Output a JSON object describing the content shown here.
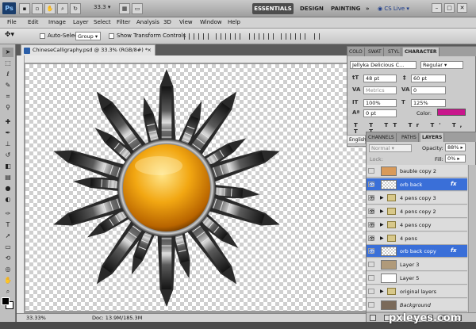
{
  "titlebar": {
    "logo": "Ps",
    "zoom": "33.3",
    "workspaces": [
      "ESSENTIALS",
      "DESIGN",
      "PAINTING"
    ],
    "more": "»",
    "cslive": "CS Live",
    "win_min": "–",
    "win_max": "□",
    "win_close": "✕"
  },
  "menu": [
    "File",
    "Edit",
    "Image",
    "Layer",
    "Select",
    "Filter",
    "Analysis",
    "3D",
    "View",
    "Window",
    "Help"
  ],
  "options": {
    "auto_select_label": "Auto-Select:",
    "auto_select_value": "Group",
    "show_transform_label": "Show Transform Controls"
  },
  "document": {
    "tab_title": "ChineseCalligraphy.psd @ 33.3% (RGB/8#) *",
    "zoom_status": "33.33%",
    "doc_status": "Doc: 13.9M/185.3M"
  },
  "character_panel": {
    "tabs": [
      "COLO",
      "SWAT",
      "STYL",
      "CHARACTER"
    ],
    "font_family": "Jellyka Delicious C...",
    "font_style": "Regular",
    "font_size": "48 pt",
    "leading": "60 pt",
    "kerning": "Metrics",
    "tracking": "0",
    "vscale": "100%",
    "hscale": "125%",
    "baseline": "0 pt",
    "color_label": "Color:",
    "text_color": "#c8168c",
    "style_buttons": "T T TT Tr T' T, T T",
    "language": "English"
  },
  "layers_panel": {
    "tabs": [
      "CHANNELS",
      "PATHS",
      "LAYERS"
    ],
    "blend_mode": "Normal",
    "opacity_label": "Opacity:",
    "opacity": "88%",
    "lock_label": "Lock:",
    "fill_label": "Fill:",
    "fill": "0%",
    "layers": [
      {
        "name": "bauble copy 2",
        "type": "image",
        "visible": false,
        "fx": false,
        "selected": false
      },
      {
        "name": "orb back",
        "type": "image",
        "visible": true,
        "fx": true,
        "selected": true
      },
      {
        "name": "4 pens copy 3",
        "type": "group",
        "visible": true,
        "fx": false,
        "selected": false
      },
      {
        "name": "4 pens copy 2",
        "type": "group",
        "visible": true,
        "fx": false,
        "selected": false
      },
      {
        "name": "4 pens copy",
        "type": "group",
        "visible": true,
        "fx": false,
        "selected": false
      },
      {
        "name": "4 pens",
        "type": "group",
        "visible": true,
        "fx": false,
        "selected": false
      },
      {
        "name": "orb back copy",
        "type": "image",
        "visible": true,
        "fx": true,
        "selected": true
      },
      {
        "name": "Layer 3",
        "type": "image",
        "visible": false,
        "fx": false,
        "selected": false
      },
      {
        "name": "Layer 5",
        "type": "image",
        "visible": false,
        "fx": false,
        "selected": false
      },
      {
        "name": "original layers",
        "type": "group",
        "visible": false,
        "fx": false,
        "selected": false
      },
      {
        "name": "Background",
        "type": "image",
        "visible": false,
        "fx": false,
        "selected": false
      }
    ]
  },
  "watermark": "pxleyes.com"
}
